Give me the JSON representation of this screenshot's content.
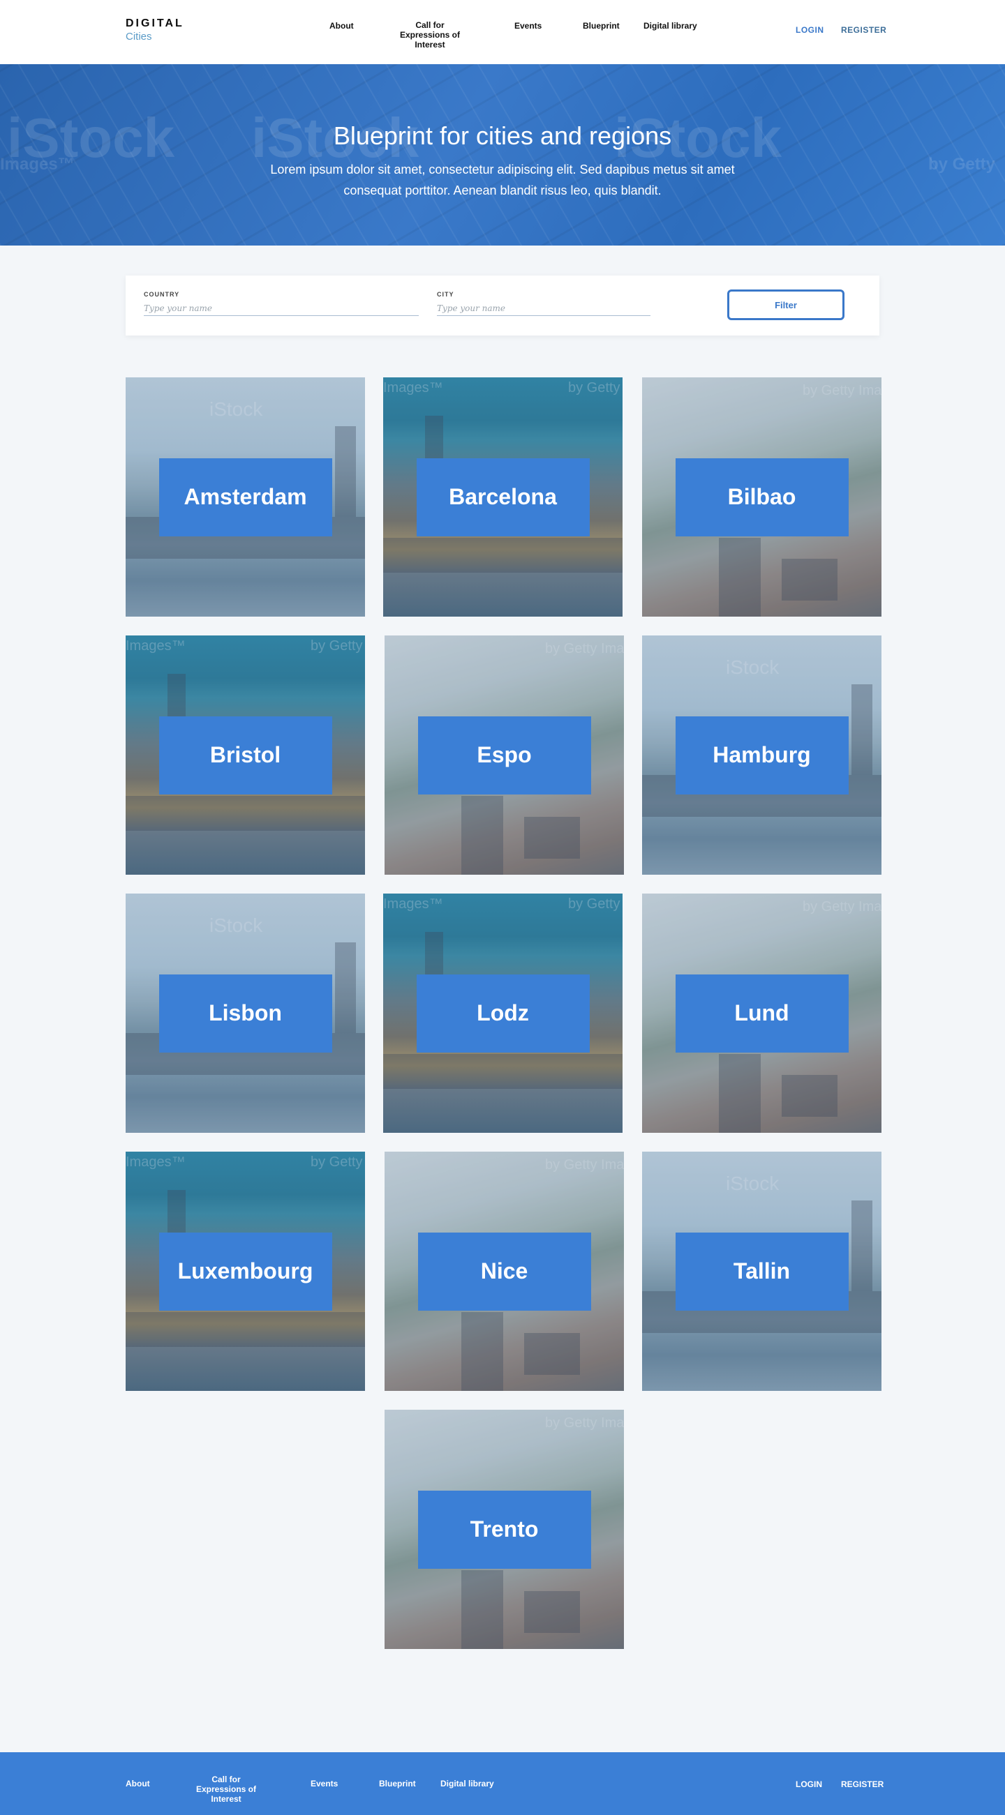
{
  "header": {
    "logo_main": "DIGITAL",
    "logo_sub": "Cities",
    "nav": [
      {
        "label": "About"
      },
      {
        "label": "Call for Expressions of Interest"
      },
      {
        "label": "Events"
      },
      {
        "label": "Blueprint"
      },
      {
        "label": "Digital library"
      }
    ],
    "login": "LOGIN",
    "register": "REGISTER"
  },
  "hero": {
    "title": "Blueprint for cities and regions",
    "text": "Lorem ipsum dolor sit amet, consectetur adipiscing elit. Sed dapibus metus sit amet consequat porttitor. Aenean blandit risus leo, quis blandit."
  },
  "filter": {
    "country_label": "COUNTRY",
    "country_placeholder": "Type your name",
    "city_label": "CITY",
    "city_placeholder": "Type your name",
    "button": "Filter"
  },
  "cities": [
    {
      "name": "Amsterdam"
    },
    {
      "name": "Barcelona"
    },
    {
      "name": "Bilbao"
    },
    {
      "name": "Bristol"
    },
    {
      "name": "Espo"
    },
    {
      "name": "Hamburg"
    },
    {
      "name": "Lisbon"
    },
    {
      "name": "Lodz"
    },
    {
      "name": "Lund"
    },
    {
      "name": "Luxembourg"
    },
    {
      "name": "Nice"
    },
    {
      "name": "Tallin"
    },
    {
      "name": "Trento"
    }
  ],
  "footer": {
    "nav": [
      {
        "label": "About"
      },
      {
        "label": "Call for Expressions of Interest"
      },
      {
        "label": "Events"
      },
      {
        "label": "Blueprint"
      },
      {
        "label": "Digital library"
      }
    ],
    "login": "LOGIN",
    "register": "REGISTER"
  },
  "colors": {
    "brand_blue": "#3b7fd6",
    "link_blue": "#3a78c9",
    "page_bg": "#f3f6f9"
  }
}
